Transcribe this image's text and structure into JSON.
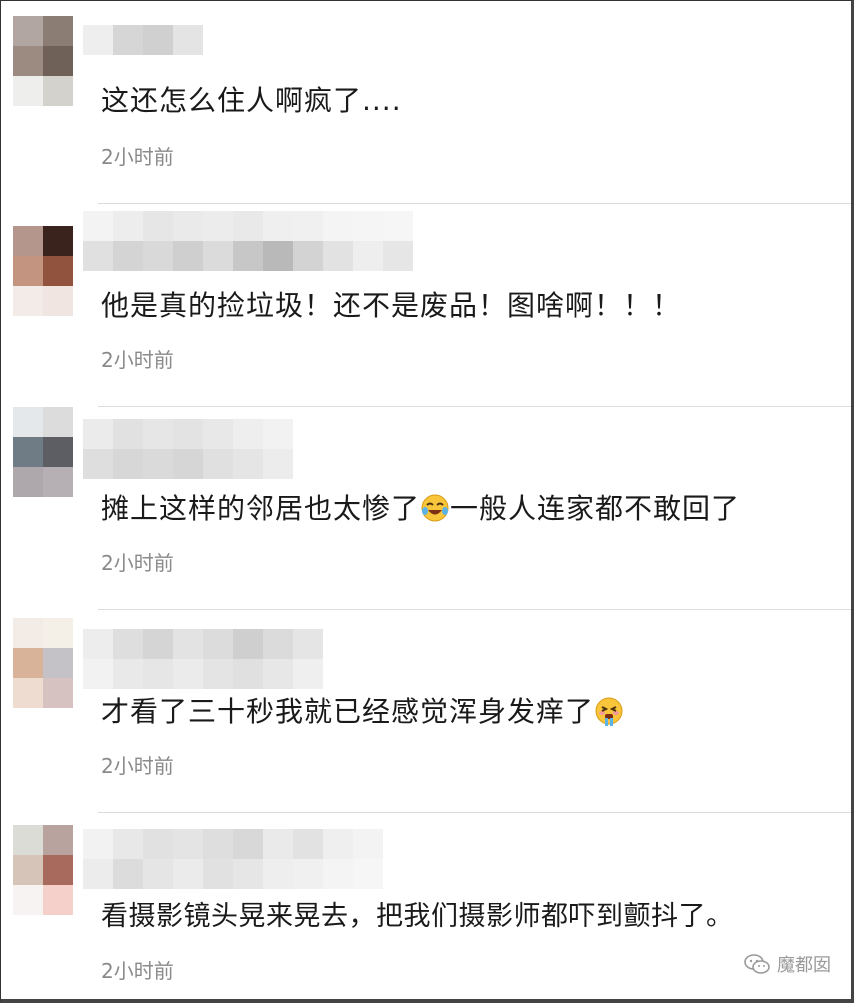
{
  "comments": [
    {
      "text": "这还怎么住人啊疯了....",
      "time": "2小时前"
    },
    {
      "text": "他是真的捡垃圾！还不是废品！图啥啊！！！",
      "time": "2小时前"
    },
    {
      "text_before": "摊上这样的邻居也太惨了",
      "emoji": "crying-laughing-emoji",
      "text_after": "一般人连家都不敢回了",
      "time": "2小时前"
    },
    {
      "text_before": "才看了三十秒我就已经感觉浑身发痒了",
      "emoji": "tearful-face-emoji",
      "time": "2小时前"
    },
    {
      "text": "看摄影镜头晃来晃去，把我们摄影师都吓到颤抖了。",
      "time": "2小时前"
    }
  ],
  "watermark": {
    "label": "魔都囡",
    "icon": "wechat-icon"
  }
}
